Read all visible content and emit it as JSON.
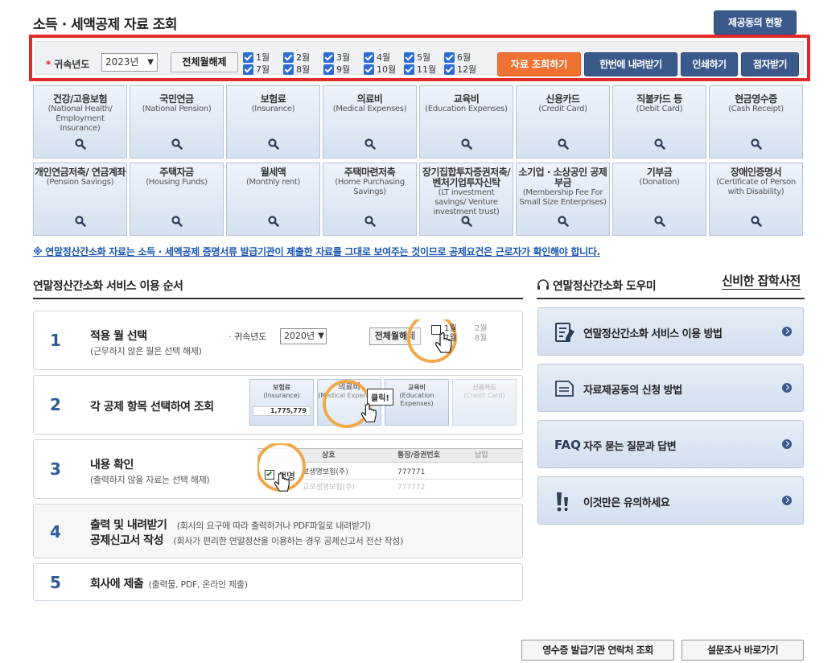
{
  "header": {
    "title": "소득 · 세액공제 자료 조회",
    "status_button": "제공동의 현황"
  },
  "search": {
    "year_label": "귀속년도",
    "required_mark": "*",
    "year_value": "2023년",
    "clear_all": "전체월해제",
    "months": [
      "1월",
      "2월",
      "3월",
      "4월",
      "5월",
      "6월",
      "7월",
      "8월",
      "9월",
      "10월",
      "11월",
      "12월"
    ],
    "actions": {
      "query": "자료 조회하기",
      "download_all": "한번에 내려받기",
      "print": "인쇄하기",
      "braille": "점자받기"
    }
  },
  "categories": [
    {
      "kr": "건강/고용보험",
      "en": "(National Health/ Employment Insurance)"
    },
    {
      "kr": "국민연금",
      "en": "(National Pension)"
    },
    {
      "kr": "보험료",
      "en": "(Insurance)"
    },
    {
      "kr": "의료비",
      "en": "(Medical Expenses)"
    },
    {
      "kr": "교육비",
      "en": "(Education Expenses)"
    },
    {
      "kr": "신용카드",
      "en": "(Credit Card)"
    },
    {
      "kr": "직불카드 등",
      "en": "(Debit Card)"
    },
    {
      "kr": "현금영수증",
      "en": "(Cash Receipt)"
    },
    {
      "kr": "개인연금저축/ 연금계좌",
      "en": "(Pension Savings)"
    },
    {
      "kr": "주택자금",
      "en": "(Housing Funds)"
    },
    {
      "kr": "월세액",
      "en": "(Monthly rent)"
    },
    {
      "kr": "주택마련저축",
      "en": "(Home Purchasing Savings)"
    },
    {
      "kr": "장기집합투자증권저축/ 벤처기업투자신탁",
      "en": "(LT investment savings/ Venture investment trust)"
    },
    {
      "kr": "소기업 · 소상공인 공제부금",
      "en": "(Membership Fee For Small Size Enterprises)"
    },
    {
      "kr": "기부금",
      "en": "(Donation)"
    },
    {
      "kr": "장애인증명서",
      "en": "(Certificate of Person with Disability)"
    }
  ],
  "notice": "※ 연말정산간소화 자료는 소득 · 세액공제 증명서류 발급기관이 제출한 자료를 그대로 보여주는 것이므로 공제요건은 근로자가 확인해야 합니다.",
  "steps_section": {
    "title": "연말정산간소화 서비스 이용 순서",
    "steps": [
      {
        "num": "1",
        "title": "적용 월 선택",
        "sub": "(근무하지 않은 월은 선택 해제)"
      },
      {
        "num": "2",
        "title": "각 공제 항목 선택하여 조회",
        "sub": ""
      },
      {
        "num": "3",
        "title": "내용 확인",
        "sub": "(출력하지 않을 자료는 선택 해제)"
      },
      {
        "num": "4",
        "title": "출력 및 내려받기",
        "title2": "공제신고서 작성",
        "note1": "(회사의 요구에 따라 출력하거나 PDF파일로 내려받기)",
        "note2": "(회사가 편리한 연말정산을 이용하는 경우 공제신고서 전산 작성)"
      },
      {
        "num": "5",
        "title": "회사에 제출",
        "note1": "(출력물, PDF, 온라인 제출)"
      }
    ],
    "illus1": {
      "label": "귀속년도",
      "year": "2020년",
      "clear": "전체월해제",
      "m1": "1월",
      "m2": "2월",
      "m7": "7월",
      "m8": "8월"
    },
    "illus2": {
      "t1": "보험료",
      "t1en": "(Insurance)",
      "t1val": "1,775,779",
      "t2": "의료비",
      "t2en": "(Medical Expenses)",
      "t3": "교육비",
      "t3en": "(Education Expenses)",
      "t4": "신용카드",
      "t4en": "(Credit Card)",
      "tooltip": "클릭!"
    },
    "illus3": {
      "col1": "상호",
      "col2": "통장/증권번호",
      "col3": "납입",
      "row1a": "생명",
      "row1b": "보생명보험(주)",
      "row1c": "777771",
      "row2b": "교보생명보험(주)",
      "row2c": "777772"
    }
  },
  "helper_section": {
    "title": "연말정산간소화 도우미",
    "link": "신비한 잡학사전",
    "cards": [
      {
        "label": "연말정산간소화 서비스 이용 방법",
        "icon": "document-pen-icon"
      },
      {
        "label": "자료제공동의 신청 방법",
        "icon": "document-icon"
      },
      {
        "label": "자주 묻는 질문과 답변",
        "icon_text": "FAQ",
        "icon": "faq-icon"
      },
      {
        "label": "이것만은 유의하세요",
        "icon": "exclamation-icon"
      }
    ]
  },
  "footer": {
    "contacts": "영수증 발급기관 연락처 조회",
    "survey": "설문조사 바로가기"
  },
  "colors": {
    "accent_navy": "#3b5a8c",
    "accent_orange": "#f07233",
    "highlight_red": "#e02b2b",
    "checkbox_blue": "#2b6cd4",
    "ring_orange": "#f0a848"
  }
}
